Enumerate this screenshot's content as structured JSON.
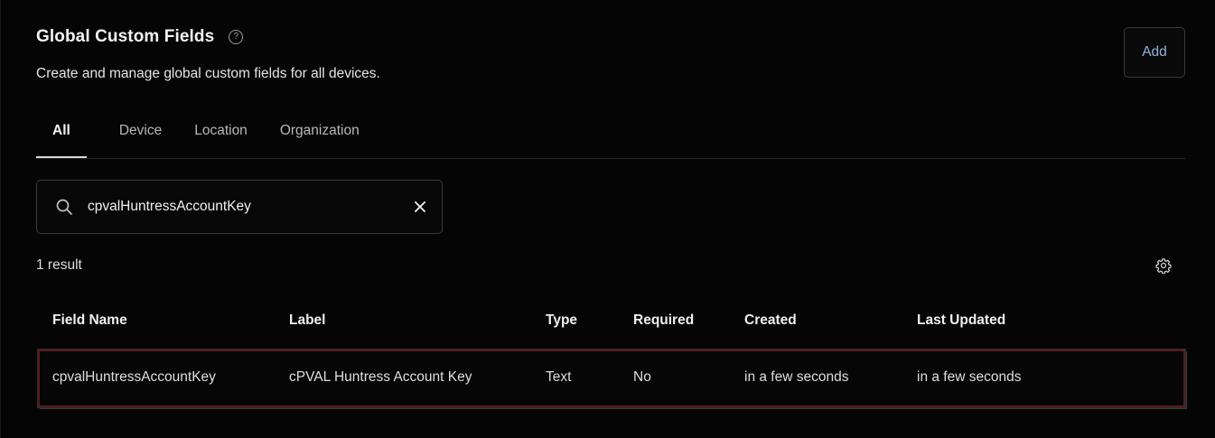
{
  "header": {
    "title": "Global Custom Fields",
    "help_glyph": "?",
    "subtitle": "Create and manage global custom fields for all devices."
  },
  "actions": {
    "add_label": "Add"
  },
  "tabs": [
    {
      "label": "All",
      "active": true
    },
    {
      "label": "Device",
      "active": false
    },
    {
      "label": "Location",
      "active": false
    },
    {
      "label": "Organization",
      "active": false
    }
  ],
  "search": {
    "value": "cpvalHuntressAccountKey",
    "placeholder": "",
    "icon": "search-icon",
    "clear_icon": "close-icon"
  },
  "results": {
    "count_text": "1 result",
    "settings_icon": "gear-icon"
  },
  "table": {
    "columns": [
      "Field Name",
      "Label",
      "Type",
      "Required",
      "Created",
      "Last Updated"
    ],
    "rows": [
      [
        "cpvalHuntressAccountKey",
        "cPVAL Huntress Account Key",
        "Text",
        "No",
        "in a few seconds",
        "in a few seconds"
      ]
    ]
  },
  "colors": {
    "background": "#050505",
    "accent": "#8fb3e0",
    "selected_row_border": "#5a1b1e"
  }
}
